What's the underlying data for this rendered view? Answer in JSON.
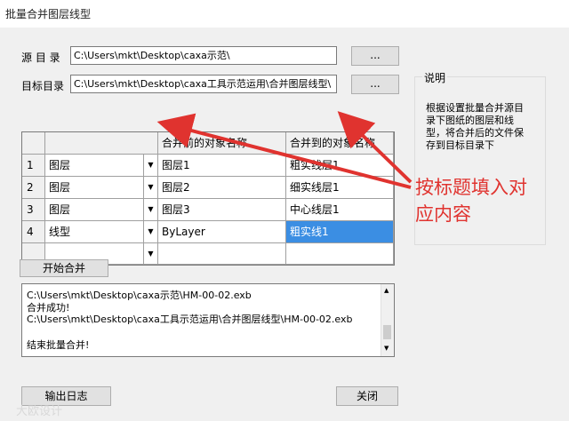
{
  "window": {
    "title": "批量合并图层线型"
  },
  "source": {
    "label": "源 目 录",
    "path": "C:\\Users\\mkt\\Desktop\\caxa示范\\",
    "browse_label": "..."
  },
  "target": {
    "label": "目标目录",
    "path": "C:\\Users\\mkt\\Desktop\\caxa工具示范运用\\合并图层线型\\",
    "browse_label": "..."
  },
  "help": {
    "title": "说明",
    "lines": [
      "根据设置批量合并源目",
      "录下图纸的图层和线",
      "型，将合并后的文件保",
      "存到目标目录下"
    ]
  },
  "grid": {
    "headers": [
      "",
      "",
      "合并前的对象名称",
      "合并到的对象名称"
    ],
    "rows": [
      {
        "num": "1",
        "type": "图层",
        "from": "图层1",
        "to": "粗实线层1",
        "selected": false
      },
      {
        "num": "2",
        "type": "图层",
        "from": "图层2",
        "to": "细实线层1",
        "selected": false
      },
      {
        "num": "3",
        "type": "图层",
        "from": "图层3",
        "to": "中心线层1",
        "selected": false
      },
      {
        "num": "4",
        "type": "线型",
        "from": "ByLayer",
        "to": "粗实线1",
        "selected": true
      },
      {
        "num": "",
        "type": "",
        "from": "",
        "to": "",
        "selected": false
      }
    ]
  },
  "start_button": "开始合并",
  "log": {
    "lines": [
      "C:\\Users\\mkt\\Desktop\\caxa示范\\HM-00-02.exb",
      " 合并成功!",
      "C:\\Users\\mkt\\Desktop\\caxa工具示范运用\\合并图层线型\\HM-00-02.exb",
      "",
      "结束批量合并!"
    ]
  },
  "export_log_button": "输出日志",
  "close_button": "关闭",
  "annotation": {
    "line1": "按标题填入对",
    "line2": "应内容",
    "color": "#e0332f"
  },
  "watermark": "大欧设计"
}
